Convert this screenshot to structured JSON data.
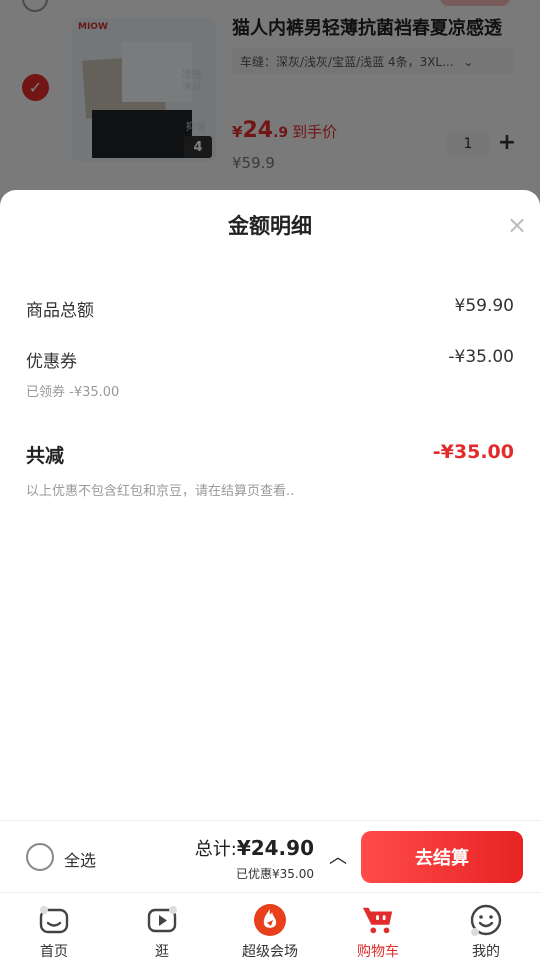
{
  "cart_item": {
    "title": "猫人内裤男轻薄抗菌裆春夏凉感透",
    "spec": "车缝：深灰/浅灰/宝蓝/浅蓝 4条，3XL...",
    "spec_chevron": "⌄",
    "price_currency": "¥",
    "price_int": "24",
    "price_dec": ".9",
    "price_suffix": "到手价",
    "original_price": "¥59.9",
    "quantity": "1",
    "plus": "+",
    "selected": true,
    "thumb_brand": "MIOW",
    "thumb_tag1": "凉感冰丝",
    "thumb_tag2": "抑菌",
    "thumb_count": "4"
  },
  "sheet": {
    "title": "金额明细",
    "close": "×",
    "rows": [
      {
        "label": "商品总额",
        "value": "¥59.90"
      },
      {
        "label": "优惠券",
        "value": "-¥35.00",
        "sub": "已领券 -¥35.00"
      }
    ],
    "total_label": "共减",
    "total_value": "-¥35.00",
    "note": "以上优惠不包含红包和京豆，请在结算页查看.."
  },
  "bottom_bar": {
    "select_all": "全选",
    "total_label": "总计:",
    "total_value": "¥24.90",
    "saved": "已优惠¥35.00",
    "chevron": "︿",
    "checkout": "去结算"
  },
  "tabs": [
    {
      "label": "首页",
      "icon": "home-icon"
    },
    {
      "label": "逛",
      "icon": "video-icon"
    },
    {
      "label": "超级会场",
      "icon": "flame-icon"
    },
    {
      "label": "购物车",
      "icon": "cart-icon",
      "active": true
    },
    {
      "label": "我的",
      "icon": "profile-icon"
    }
  ],
  "colors": {
    "accent": "#e22b2b",
    "overlay": "rgba(0,0,0,0.5)"
  }
}
